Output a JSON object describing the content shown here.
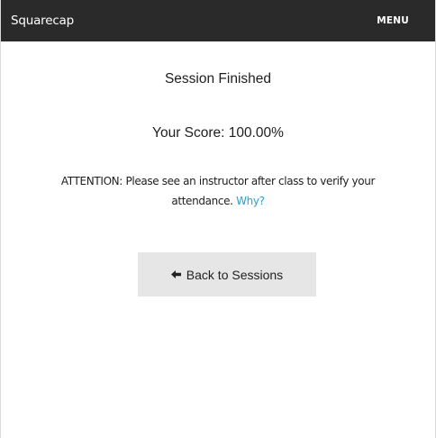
{
  "header": {
    "brand": "Squarecap",
    "menu_label": "MENU"
  },
  "main": {
    "title": "Session Finished",
    "score_text": "Your Score: 100.00%",
    "attention_text": "ATTENTION: Please see an instructor after class to verify your attendance.",
    "why_link": "Why?",
    "back_button_label": "Back to Sessions",
    "back_button_icon": "arrow-left-icon"
  },
  "colors": {
    "header_bg": "#2a2a2a",
    "link": "#2b9fc6",
    "button_bg": "#e6e6e6"
  }
}
